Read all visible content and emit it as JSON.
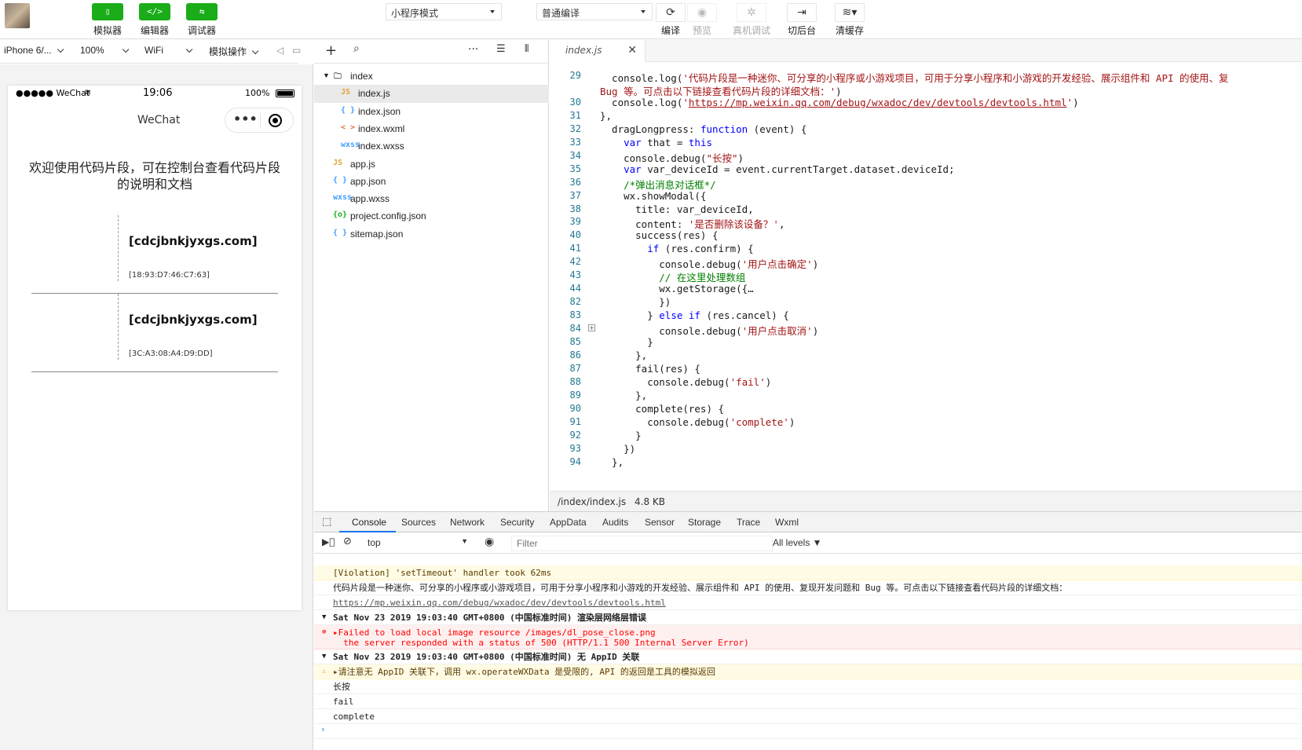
{
  "toolbar": {
    "modes": [
      {
        "icon": "phone-icon",
        "glyph": "▯",
        "label": "模拟器"
      },
      {
        "icon": "code-icon",
        "glyph": "</>",
        "label": "编辑器"
      },
      {
        "icon": "debug-icon",
        "glyph": "⇆",
        "label": "调试器"
      }
    ],
    "project_mode": "小程序模式",
    "compile_mode": "普通编译",
    "actions": [
      {
        "icon": "refresh-icon",
        "glyph": "⟳",
        "label": "编译",
        "enabled": true
      },
      {
        "icon": "eye-icon",
        "glyph": "◉",
        "label": "预览",
        "enabled": false
      },
      {
        "icon": "bug-icon",
        "glyph": "✲",
        "label": "真机调试",
        "enabled": false
      },
      {
        "icon": "switch-icon",
        "glyph": "⇥",
        "label": "切后台",
        "enabled": true
      },
      {
        "icon": "layers-icon",
        "glyph": "≋▾",
        "label": "清缓存",
        "enabled": true
      }
    ]
  },
  "simbar": {
    "device": "iPhone 6/...",
    "zoom": "100%",
    "network": "WiFi",
    "ops": "模拟操作"
  },
  "phone": {
    "carrier": "●●●●● WeChat",
    "time": "19:06",
    "battery": "100%",
    "nav_title": "WeChat",
    "welcome": "欢迎使用代码片段，可在控制台查看代码片段的说明和文档",
    "devices": [
      {
        "name": "[cdcjbnkjyxgs.com]",
        "id": "[18:93:D7:46:C7:63]"
      },
      {
        "name": "[cdcjbnkjyxgs.com]",
        "id": "[3C:A3:08:A4:D9:DD]"
      }
    ]
  },
  "filetree": {
    "items": [
      {
        "name": "index",
        "icon": "folder-icon",
        "glyph": "🗀",
        "level": 0,
        "color": "#555"
      },
      {
        "name": "index.js",
        "icon": "js-file-icon",
        "glyph": "JS",
        "level": 1,
        "color": "#e6a23c",
        "selected": true
      },
      {
        "name": "index.json",
        "icon": "json-file-icon",
        "glyph": "{ }",
        "level": 1,
        "color": "#409eff"
      },
      {
        "name": "index.wxml",
        "icon": "wxml-file-icon",
        "glyph": "< >",
        "level": 1,
        "color": "#e6743c"
      },
      {
        "name": "index.wxss",
        "icon": "wxss-file-icon",
        "glyph": "wxss",
        "level": 1,
        "color": "#409eff"
      },
      {
        "name": "app.js",
        "icon": "js-file-icon",
        "glyph": "JS",
        "level": 0,
        "color": "#e6a23c"
      },
      {
        "name": "app.json",
        "icon": "json-file-icon",
        "glyph": "{ }",
        "level": 0,
        "color": "#409eff"
      },
      {
        "name": "app.wxss",
        "icon": "wxss-file-icon",
        "glyph": "wxss",
        "level": 0,
        "color": "#409eff"
      },
      {
        "name": "project.config.json",
        "icon": "config-file-icon",
        "glyph": "{o}",
        "level": 0,
        "color": "#1aad19"
      },
      {
        "name": "sitemap.json",
        "icon": "json-file-icon",
        "glyph": "{ }",
        "level": 0,
        "color": "#409eff"
      }
    ]
  },
  "editor": {
    "tab": "index.js",
    "status_path": "/index/index.js",
    "status_size": "4.8 KB",
    "lines": [
      {
        "n": "29",
        "html": "  console.log(<span class=\"st\">'代码片段是一种迷你、可分享的小程序或小游戏项目，可用于分享小程序和小游戏的开发经验、展示组件和 API 的使用、复</span>"
      },
      {
        "n": "",
        "html": "<span class=\"st\">Bug 等。可点击以下链接查看代码片段的详细文档：'</span>)"
      },
      {
        "n": "30",
        "html": "  console.log(<span class=\"st\">'</span><span class=\"lk\">https://mp.weixin.qq.com/debug/wxadoc/dev/devtools/devtools.html</span><span class=\"st\">'</span>)"
      },
      {
        "n": "31",
        "html": "},"
      },
      {
        "n": "32",
        "html": "  dragLongpress: <span class=\"kw\">function</span> (event) {"
      },
      {
        "n": "33",
        "html": "    <span class=\"kw\">var</span> that = <span class=\"kw\">this</span>"
      },
      {
        "n": "34",
        "html": "    console.debug(<span class=\"st\">\"长按\"</span>)"
      },
      {
        "n": "35",
        "html": "    <span class=\"kw\">var</span> var_deviceId = event.currentTarget.dataset.deviceId;"
      },
      {
        "n": "36",
        "html": "    <span class=\"cm\">/*弹出消息对话框*/</span>"
      },
      {
        "n": "37",
        "html": "    wx.showModal({"
      },
      {
        "n": "38",
        "html": "      title: var_deviceId,"
      },
      {
        "n": "39",
        "html": "      content: <span class=\"st\">'是否删除该设备？'</span>,"
      },
      {
        "n": "40",
        "html": "      success(res) {"
      },
      {
        "n": "41",
        "html": "        <span class=\"kw\">if</span> (res.confirm) {"
      },
      {
        "n": "42",
        "html": "          console.debug(<span class=\"st\">'用户点击确定'</span>)"
      },
      {
        "n": "43",
        "html": "          <span class=\"cm\">// 在这里处理数组</span>"
      },
      {
        "n": "44",
        "html": "          wx.getStorage({…"
      },
      {
        "n": "82",
        "html": "          })"
      },
      {
        "n": "83",
        "html": "        } <span class=\"kw\">else if</span> (res.cancel) {"
      },
      {
        "n": "84",
        "html": "          console.debug(<span class=\"st\">'用户点击取消'</span>)"
      },
      {
        "n": "85",
        "html": "        }"
      },
      {
        "n": "86",
        "html": "      },"
      },
      {
        "n": "87",
        "html": "      fail(res) {"
      },
      {
        "n": "88",
        "html": "        console.debug(<span class=\"st\">'fail'</span>)"
      },
      {
        "n": "89",
        "html": "      },"
      },
      {
        "n": "90",
        "html": "      complete(res) {"
      },
      {
        "n": "91",
        "html": "        console.debug(<span class=\"st\">'complete'</span>)"
      },
      {
        "n": "92",
        "html": "      }"
      },
      {
        "n": "93",
        "html": "    })"
      },
      {
        "n": "94",
        "html": "  },"
      }
    ]
  },
  "devtools": {
    "tabs": [
      "Console",
      "Sources",
      "Network",
      "Security",
      "AppData",
      "Audits",
      "Sensor",
      "Storage",
      "Trace",
      "Wxml"
    ],
    "active_tab": "Console",
    "context": "top",
    "filter_placeholder": "Filter",
    "levels": "All levels ▼",
    "messages": [
      {
        "type": "warn",
        "text": "[Violation] 'setTimeout' handler took 62ms"
      },
      {
        "type": "log",
        "text": "代码片段是一种迷你、可分享的小程序或小游戏项目，可用于分享小程序和小游戏的开发经验、展示组件和 API 的使用、复现开发问题和 Bug 等。可点击以下链接查看代码片段的详细文档："
      },
      {
        "type": "link",
        "text": "https://mp.weixin.qq.com/debug/wxadoc/dev/devtools/devtools.html"
      },
      {
        "type": "grp",
        "text": "Sat Nov 23 2019 19:03:40 GMT+0800 (中国标准时间) 渲染层网络层错误"
      },
      {
        "type": "err",
        "text": "▸Failed to load local image resource /images/dl_pose_close.png\n  the server responded with a status of 500 (HTTP/1.1 500 Internal Server Error)"
      },
      {
        "type": "grp",
        "text": "Sat Nov 23 2019 19:03:40 GMT+0800 (中国标准时间) 无 AppID 关联"
      },
      {
        "type": "warn",
        "text": "▸请注意无 AppID 关联下，调用 wx.operateWXData 是受限的, API 的返回是工具的模拟返回"
      },
      {
        "type": "log",
        "text": "长按"
      },
      {
        "type": "log",
        "text": "fail"
      },
      {
        "type": "log",
        "text": "complete"
      }
    ],
    "prompt": "›"
  }
}
